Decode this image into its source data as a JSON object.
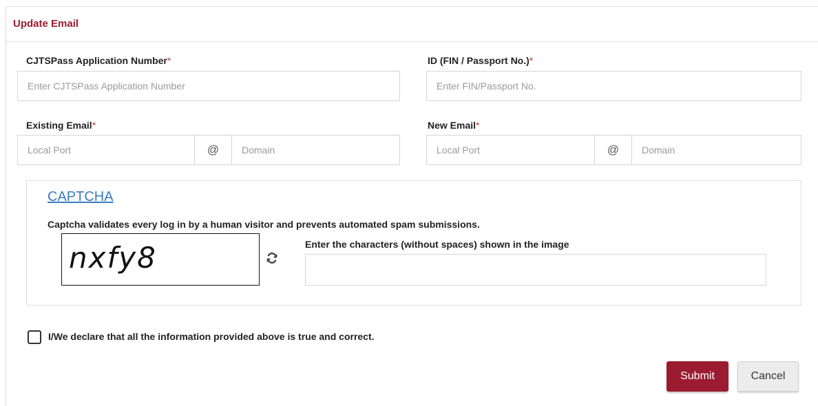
{
  "header": {
    "title": "Update Email"
  },
  "application_number": {
    "label": "CJTSPass Application Number",
    "required_mark": "*",
    "placeholder": "Enter CJTSPass Application Number",
    "value": ""
  },
  "id_number": {
    "label": "ID (FIN / Passport No.)",
    "required_mark": "*",
    "placeholder": "Enter FIN/Passport No.",
    "value": ""
  },
  "existing_email": {
    "label": "Existing Email",
    "required_mark": "*",
    "local_placeholder": "Local Port",
    "at_symbol": "@",
    "domain_placeholder": "Domain"
  },
  "new_email": {
    "label": "New Email",
    "required_mark": "*",
    "local_placeholder": "Local Port",
    "at_symbol": "@",
    "domain_placeholder": "Domain"
  },
  "captcha": {
    "title": "CAPTCHA",
    "description": "Captcha validates every log in by a human visitor and prevents automated spam submissions.",
    "image_text": "nxfy8",
    "input_label": "Enter the characters (without spaces) shown in the image",
    "refresh_icon": "refresh-icon"
  },
  "declaration": {
    "text": "I/We declare that all the information provided above is true and correct.",
    "checked": false
  },
  "actions": {
    "submit_label": "Submit",
    "cancel_label": "Cancel"
  },
  "colors": {
    "brand": "#9b1b30",
    "link": "#3a7bbf",
    "required": "#c0392b"
  }
}
